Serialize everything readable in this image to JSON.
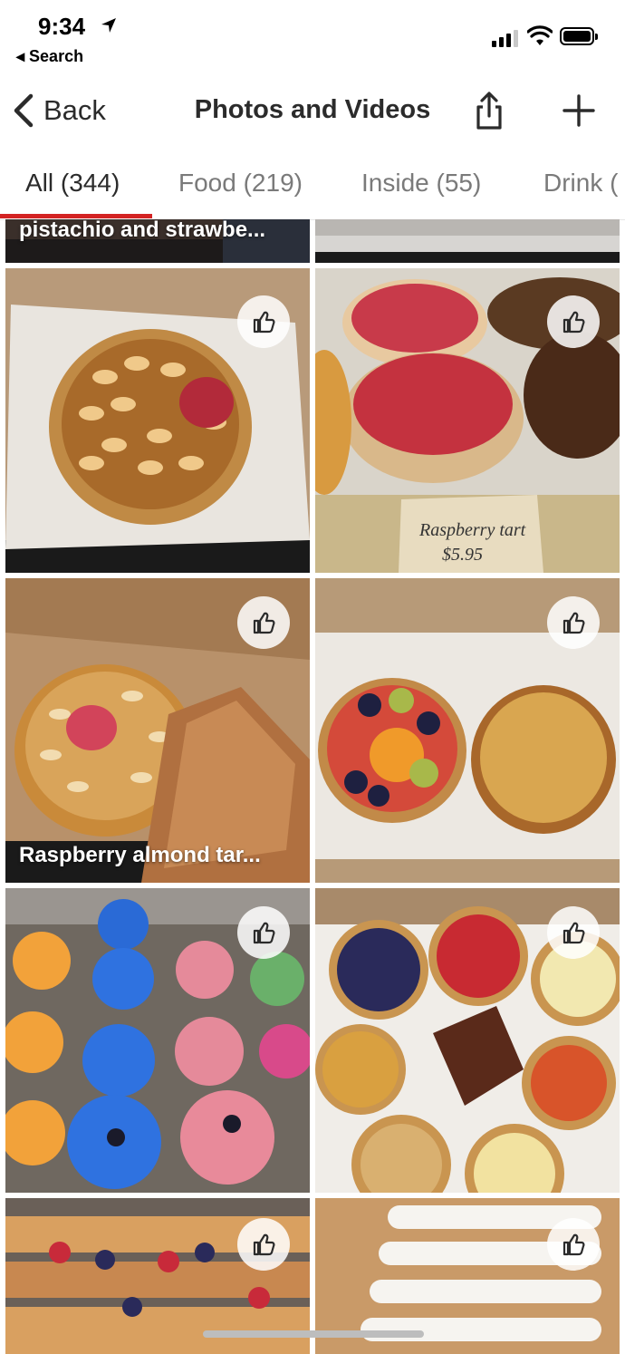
{
  "status_bar": {
    "time": "9:34",
    "back_app": "◂ Search"
  },
  "nav": {
    "back_label": "Back",
    "title": "Photos and Videos"
  },
  "tabs": [
    {
      "label": "All (344)",
      "active": true
    },
    {
      "label": "Food (219)"
    },
    {
      "label": "Inside (55)"
    },
    {
      "label": "Drink ("
    }
  ],
  "photos": [
    {
      "caption": "pistachio and strawbe..."
    },
    {
      "caption": ""
    },
    {
      "caption": "",
      "handwritten_label": "Raspberry tart $5.95"
    },
    {
      "caption": ""
    },
    {
      "caption": "Raspberry almond tar..."
    },
    {
      "caption": ""
    },
    {
      "caption": ""
    },
    {
      "caption": ""
    },
    {
      "caption": ""
    },
    {
      "caption": ""
    }
  ],
  "colors": {
    "accent_red": "#d32323",
    "text_primary": "#2b2b2b",
    "text_muted": "#7a7a7a"
  },
  "icons": [
    "location-arrow-icon",
    "signal-icon",
    "wifi-icon",
    "battery-icon",
    "chevron-left-icon",
    "share-icon",
    "plus-icon",
    "thumbs-up-icon"
  ]
}
